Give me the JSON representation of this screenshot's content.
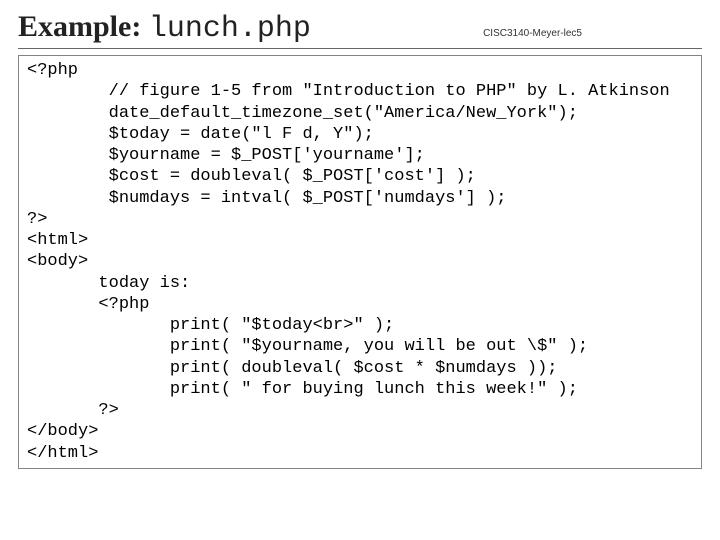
{
  "header": {
    "title_prefix": "Example: ",
    "title_code": "lunch.php",
    "course": "CISC3140-Meyer-lec5"
  },
  "code": {
    "l0": "<?php",
    "l1": "        // figure 1-5 from \"Introduction to PHP\" by L. Atkinson",
    "l2": "        date_default_timezone_set(\"America/New_York\");",
    "l3": "        $today = date(\"l F d, Y\");",
    "l4": "        $yourname = $_POST['yourname'];",
    "l5": "        $cost = doubleval( $_POST['cost'] );",
    "l6": "        $numdays = intval( $_POST['numdays'] );",
    "l7": "?>",
    "l8": "<html>",
    "l9": "<body>",
    "l10": "       today is:",
    "l11": "       <?php",
    "l12": "              print( \"$today<br>\" );",
    "l13": "              print( \"$yourname, you will be out \\$\" );",
    "l14": "              print( doubleval( $cost * $numdays ));",
    "l15": "              print( \" for buying lunch this week!\" );",
    "l16": "       ?>",
    "l17": "</body>",
    "l18": "</html>"
  }
}
